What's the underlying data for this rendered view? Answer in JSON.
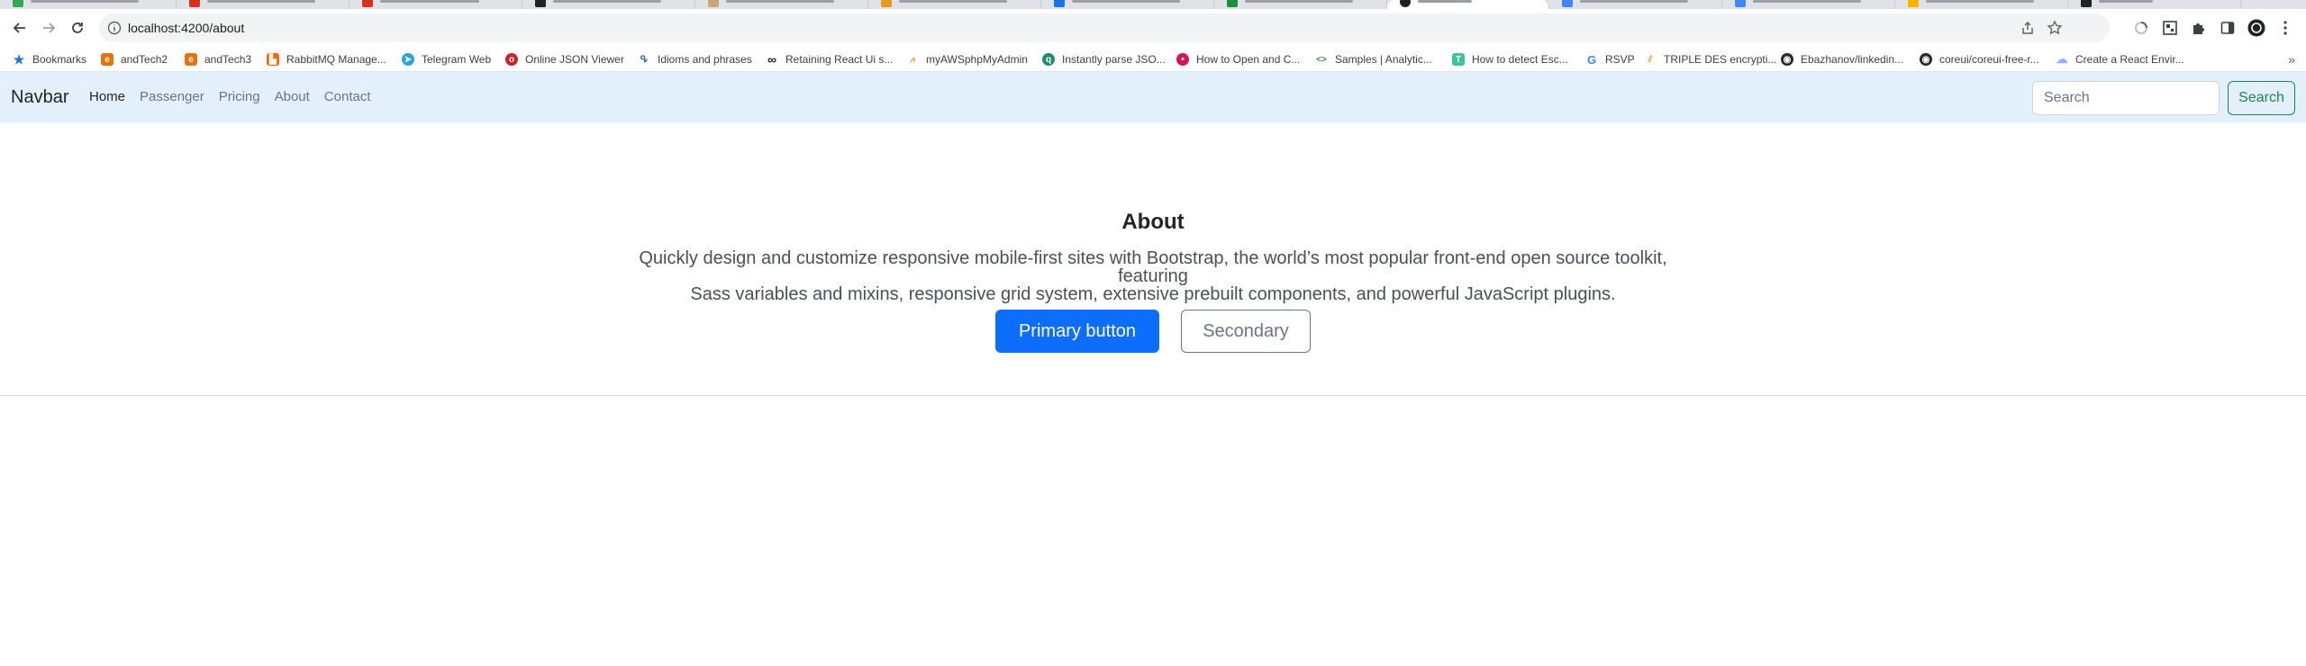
{
  "browser": {
    "url": "localhost:4200/about",
    "bookmarks": [
      {
        "label": "Bookmarks",
        "color": "#1a73e8",
        "icon": "star-icon"
      },
      {
        "label": "andTech2",
        "color": "#e8710a",
        "icon": "ep-logo-icon"
      },
      {
        "label": "andTech3",
        "color": "#e8710a",
        "icon": "ep-logo-icon"
      },
      {
        "label": "RabbitMQ Manage...",
        "color": "#f60",
        "icon": "rabbitmq-icon"
      },
      {
        "label": "Telegram Web",
        "color": "#2aa3df",
        "icon": "telegram-icon"
      },
      {
        "label": "Online JSON Viewer",
        "color": "#cc2222",
        "icon": "json-viewer-icon"
      },
      {
        "label": "Idioms and phrases",
        "color": "#2b6cb0",
        "icon": "idioms-icon"
      },
      {
        "label": "Retaining React Ui s...",
        "color": "#222222",
        "icon": "infinity-icon"
      },
      {
        "label": "myAWSphpMyAdmin",
        "color": "#e59b1c",
        "icon": "phpmyadmin-icon"
      },
      {
        "label": "Instantly parse JSO...",
        "color": "#1f8f6a",
        "icon": "quicktype-icon"
      },
      {
        "label": "How to Open and C...",
        "color": "#d3145a",
        "icon": "site-icon"
      },
      {
        "label": "Samples | Analytic...",
        "color": "#3c8c3c",
        "icon": "code-icon"
      },
      {
        "label": "How to detect Esc...",
        "color": "#3cc4a0",
        "icon": "ti-icon"
      },
      {
        "label": "RSVP",
        "color": "#4285f4",
        "icon": "google-icon"
      },
      {
        "label": "TRIPLE DES encrypti...",
        "color": "#e6a23c",
        "icon": "des-icon"
      },
      {
        "label": "Ebazhanov/linkedin...",
        "color": "#24292f",
        "icon": "github-icon"
      },
      {
        "label": "coreui/coreui-free-r...",
        "color": "#24292f",
        "icon": "github-icon"
      },
      {
        "label": "Create a React Envir...",
        "color": "#8ab4f8",
        "icon": "cloud-icon"
      }
    ]
  },
  "navbar": {
    "brand": "Navbar",
    "links": [
      {
        "label": "Home",
        "active": true
      },
      {
        "label": "Passenger",
        "active": false
      },
      {
        "label": "Pricing",
        "active": false
      },
      {
        "label": "About",
        "active": false
      },
      {
        "label": "Contact",
        "active": false
      }
    ],
    "search_placeholder": "Search",
    "search_button": "Search"
  },
  "hero": {
    "title": "About",
    "lead_line1": "Quickly design and customize responsive mobile-first sites with Bootstrap, the world’s most popular front-end open source toolkit, featuring",
    "lead_line2": "Sass variables and mixins, responsive grid system, extensive prebuilt components, and powerful JavaScript plugins.",
    "primary_button": "Primary button",
    "secondary_button": "Secondary"
  },
  "colors": {
    "primary": "#0d6efd",
    "success": "#198754",
    "navbar_bg": "#e3f0fb"
  }
}
